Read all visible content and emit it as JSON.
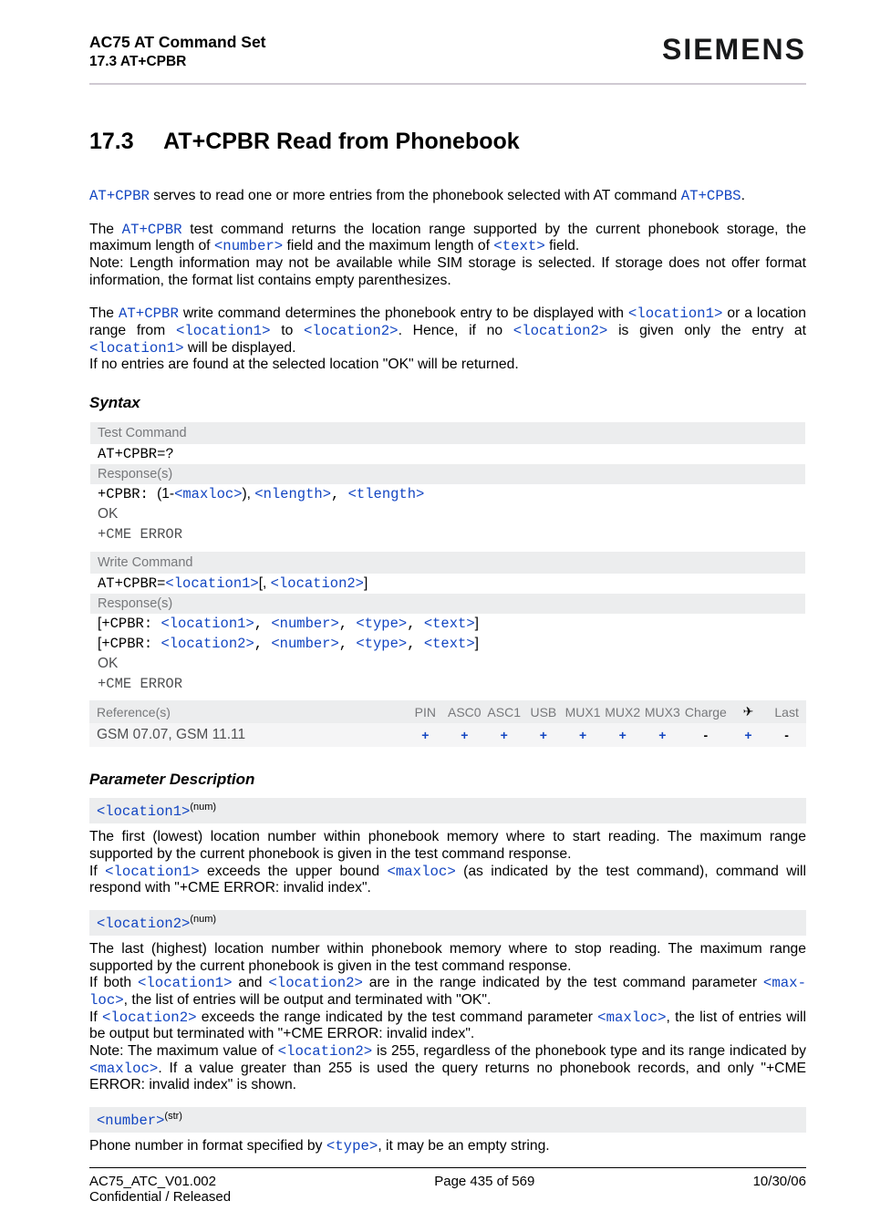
{
  "header": {
    "title": "AC75 AT Command Set",
    "subtitle": "17.3 AT+CPBR",
    "brand": "SIEMENS"
  },
  "h1": {
    "num": "17.3",
    "text": "AT+CPBR   Read from Phonebook"
  },
  "intro": {
    "atcpbr": "AT+CPBR",
    "atcpbs": "AT+CPBS",
    "p1_a": " serves to read one or more entries from the phonebook selected with AT command ",
    "p1_end": ".",
    "p2_a": "The ",
    "p2_b": " test command returns the location range supported by the current phonebook storage, the maximum length of ",
    "p2_number": "<number>",
    "p2_c": " field and the maximum length of ",
    "p2_text": "<text>",
    "p2_d": " field.",
    "p2_note": "Note: Length information may not be available while SIM storage is selected. If storage does not offer format information, the format list contains empty parenthesizes.",
    "p3_a": "The ",
    "p3_b": " write command determines the phonebook entry to be displayed with ",
    "loc1": "<location1>",
    "loc2": "<location2>",
    "p3_c": " or a location range from ",
    "p3_d": " to ",
    "p3_e": ". Hence, if no ",
    "p3_f": " is given only the entry at ",
    "p3_g": " will be displayed.",
    "p3_last": "If no entries are found at the selected location \"OK\" will be returned."
  },
  "syntax": {
    "title": "Syntax",
    "testcmd_label": "Test Command",
    "testcmd": "AT+CPBR=?",
    "responses_label": "Response(s)",
    "test_resp_prefix": "+CPBR: ",
    "test_resp_open": "(1-",
    "maxloc": "<maxloc>",
    "test_resp_close": "), ",
    "nlength": "<nlength>",
    "tlength": "<tlength>",
    "ok": "OK",
    "cmeerr": "+CME ERROR",
    "writecmd_label": "Write Command",
    "writecmd_prefix": "AT+CPBR=",
    "writecmd_open": "[, ",
    "writecmd_close": "]",
    "wr_line_open": "[",
    "wr_line_mid": "+CPBR: ",
    "number": "<number>",
    "type": "<type>",
    "text": "<text>",
    "wr_line_close": "]",
    "comma": ", "
  },
  "ref": {
    "references_label": "Reference(s)",
    "references_value": "GSM 07.07, GSM 11.11",
    "cols": [
      "PIN",
      "ASC0",
      "ASC1",
      "USB",
      "MUX1",
      "MUX2",
      "MUX3",
      "Charge",
      "✈",
      "Last"
    ],
    "vals": [
      "+",
      "+",
      "+",
      "+",
      "+",
      "+",
      "+",
      "-",
      "+",
      "-"
    ]
  },
  "pd": {
    "title": "Parameter Description",
    "loc1_name": "<location1>",
    "num_sup": "(num)",
    "str_sup": "(str)",
    "loc1_p1": "The first (lowest) location number within phonebook memory where to start reading. The maximum range supported by the current phonebook is given in the test command response.",
    "loc1_p2a": "If ",
    "loc1_p2b": " exceeds the upper bound ",
    "maxloc": "<maxloc>",
    "loc1_p2c": " (as indicated by the test command), command will respond with \"+CME ERROR: invalid index\".",
    "loc2_name": "<location2>",
    "loc2_p1": "The last (highest) location number within phonebook memory where to stop reading. The maximum range supported by the current phonebook is given in the test command response.",
    "loc2_p2a": "If both ",
    "loc2_p2b": " and ",
    "loc2_p2c": " are in the range indicated by the test command parameter ",
    "maxloc_hyph": "<max-loc>",
    "loc2_p2d": ", the list of entries will be output and terminated with \"OK\".",
    "loc2_p3a": "If ",
    "loc2_p3b": " exceeds the range indicated by the test command parameter ",
    "loc2_p3c": ", the list of entries will be output but terminated with \"+CME ERROR: invalid index\".",
    "loc2_note_a": "Note: The maximum value of ",
    "loc2_note_b": " is 255, regardless of the phonebook type and its range indicated by ",
    "loc2_note_c": ". If a value greater than 255 is used the query returns no phonebook records, and only \"+CME ERROR: invalid index\" is shown.",
    "number_name": "<number>",
    "number_p_a": "Phone number in format specified by ",
    "type": "<type>",
    "number_p_b": ", it may be an empty string."
  },
  "footer": {
    "left": "AC75_ATC_V01.002",
    "center": "Page 435 of 569",
    "right": "10/30/06",
    "left2": "Confidential / Released"
  }
}
